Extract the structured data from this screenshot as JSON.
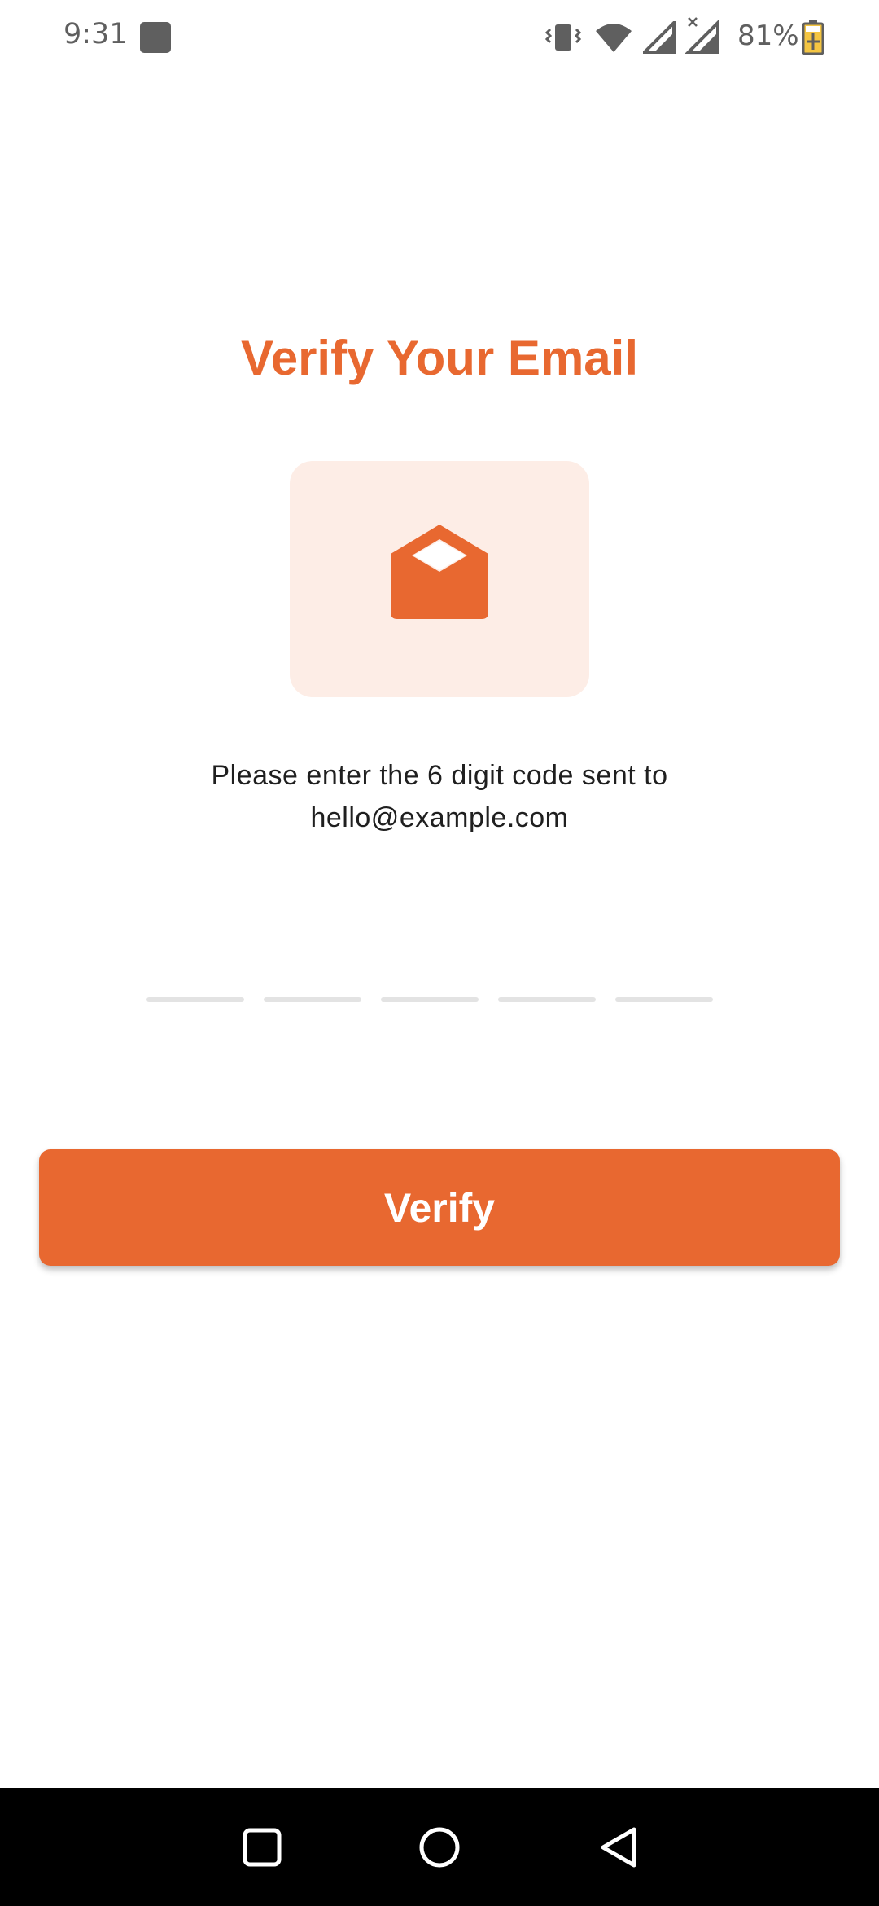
{
  "status_bar": {
    "time": "9:31",
    "battery": "81%",
    "icons": [
      "app-notification-icon",
      "vibrate-icon",
      "wifi-icon",
      "signal-icon",
      "signal-no-data-icon",
      "battery-charging-icon"
    ]
  },
  "screen": {
    "title": "Verify Your Email",
    "illustration_icon": "open-envelope-icon",
    "instruction_line1": "Please enter the 6 digit code sent to",
    "instruction_line2": "hello@example.com",
    "code_slots": [
      "",
      "",
      "",
      "",
      ""
    ],
    "verify_label": "Verify"
  },
  "nav_bar": {
    "icons": [
      "recents-square-icon",
      "home-circle-icon",
      "back-triangle-icon"
    ]
  },
  "colors": {
    "accent": "#e86830",
    "tile_background": "#fdede6",
    "text": "#1f1f1f",
    "slot_line": "#e3e3e3"
  }
}
